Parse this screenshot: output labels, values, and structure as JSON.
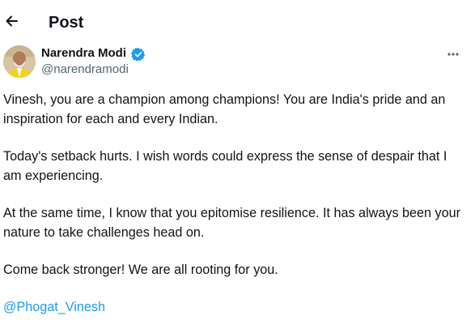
{
  "header": {
    "back_icon": "arrow-left-icon",
    "title": "Post"
  },
  "author": {
    "name": "Narendra Modi",
    "handle": "@narendramodi",
    "verified_icon": "verified-badge-icon",
    "verified_color": "#1d9bf0",
    "avatar_icon": "profile-photo"
  },
  "more_icon": "more-options-icon",
  "post": {
    "paragraphs": [
      "Vinesh, you are a champion among champions! You are India's pride and an inspiration for each and every Indian.",
      "Today's setback hurts. I wish words could express the sense of despair that I am experiencing.",
      "At the same time, I know that you epitomise resilience. It has always been your nature to take challenges head on.",
      "Come back stronger! We are all rooting for you."
    ],
    "mention": "@Phogat_Vinesh"
  },
  "colors": {
    "text": "#0f1419",
    "secondary": "#536471",
    "link": "#1d9bf0"
  }
}
